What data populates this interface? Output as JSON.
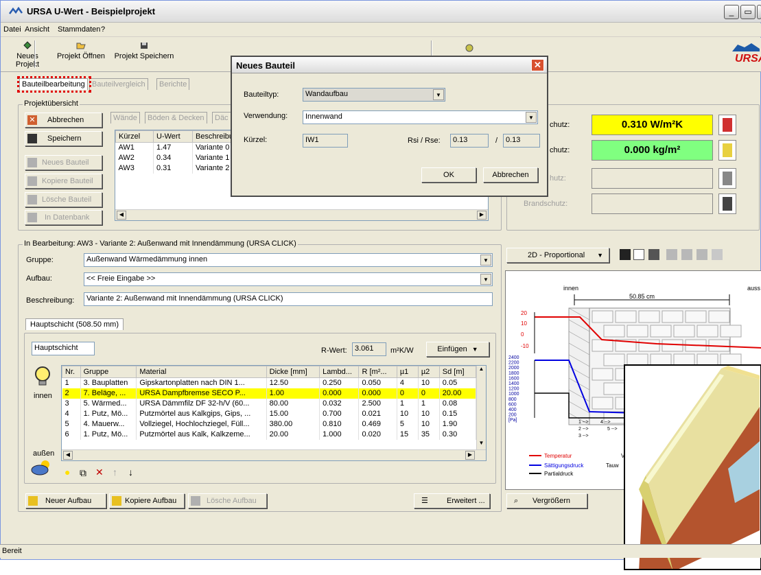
{
  "window": {
    "title": "URSA U-Wert - Beispielprojekt",
    "buttons": [
      "_",
      "▭",
      "✕"
    ]
  },
  "menu": [
    "Datei",
    "Ansicht",
    "Stammdaten",
    "?"
  ],
  "toolbar": {
    "items": [
      "Neues Projekt",
      "Projekt Öffnen",
      "Projekt Speichern"
    ],
    "brand": "URSA"
  },
  "main_tabs": [
    "Bauteilbearbeitung",
    "Bauteilvergleich",
    "Berichte"
  ],
  "project_overview": {
    "label": "Projektübersicht",
    "buttons": {
      "abbrechen": "Abbrechen",
      "speichern": "Speichern",
      "neues": "Neues Bauteil",
      "kopiere": "Kopiere Bauteil",
      "loesche": "Lösche Bauteil",
      "datenbank": "In Datenbank"
    },
    "category_tabs": [
      "Wände",
      "Böden & Decken",
      "Däc"
    ],
    "columns": [
      "Kürzel",
      "U-Wert",
      "Beschreibu"
    ],
    "rows": [
      [
        "AW1",
        "1.47",
        "Variante 0"
      ],
      [
        "AW2",
        "0.34",
        "Variante 1"
      ],
      [
        "AW3",
        "0.31",
        "Variante 2"
      ]
    ]
  },
  "results": {
    "rows": [
      {
        "label": "chutz:",
        "value": "0.310 W/m²K",
        "color": "#ffff00",
        "icon": "thermal-icon"
      },
      {
        "label": "chutz:",
        "value": "0.000 kg/m²",
        "color": "#80ff80",
        "icon": "moisture-icon"
      },
      {
        "label": "hutz:",
        "value": "",
        "color": "#ece9d8",
        "icon": "sound-icon"
      },
      {
        "label": "Brandschutz:",
        "value": "",
        "color": "#ece9d8",
        "icon": "fire-icon"
      }
    ]
  },
  "editing": {
    "title": "In Bearbeitung: AW3 - Variante 2: Außenwand mit Innendämmung (URSA CLICK)",
    "gruppe_label": "Gruppe:",
    "gruppe_value": "Außenwand Wärmedämmung innen",
    "aufbau_label": "Aufbau:",
    "aufbau_value": "<< Freie Eingabe >>",
    "beschreibung_label": "Beschreibung:",
    "beschreibung_value": "Variante 2: Außenwand mit Innendämmung (URSA CLICK)",
    "layer_tab": "Hauptschicht (508.50 mm)",
    "layer_name": "Hauptschicht",
    "r_wert_label": "R-Wert:",
    "r_wert_value": "3.061",
    "r_unit": "m²K/W",
    "einfuegen": "Einfügen",
    "innen": "innen",
    "aussen": "außen"
  },
  "layers": {
    "columns": [
      "Nr.",
      "Gruppe",
      "Material",
      "Dicke [mm]",
      "Lambd...",
      "R [m²...",
      "µ1",
      "µ2",
      "Sd [m]"
    ],
    "rows": [
      [
        "1",
        "3. Bauplatten",
        "Gipskartonplatten nach DIN 1...",
        "12.50",
        "0.250",
        "0.050",
        "4",
        "10",
        "0.05"
      ],
      [
        "2",
        "7. Beläge, ...",
        "URSA Dampfbremse SECO P...",
        "1.00",
        "0.000",
        "0.000",
        "0",
        "0",
        "20.00"
      ],
      [
        "3",
        "5. Wärmed...",
        "URSA Dämmfilz DF 32-h/V (60...",
        "80.00",
        "0.032",
        "2.500",
        "1",
        "1",
        "0.08"
      ],
      [
        "4",
        "1. Putz, Mö...",
        "Putzmörtel aus Kalkgips, Gips, ...",
        "15.00",
        "0.700",
        "0.021",
        "10",
        "10",
        "0.15"
      ],
      [
        "5",
        "4. Mauerw...",
        "Vollziegel, Hochlochziegel, Füll...",
        "380.00",
        "0.810",
        "0.469",
        "5",
        "10",
        "1.90"
      ],
      [
        "6",
        "1. Putz, Mö...",
        "Putzmörtel aus Kalk, Kalkzeme...",
        "20.00",
        "1.000",
        "0.020",
        "15",
        "35",
        "0.30"
      ]
    ],
    "selected_row": 1
  },
  "bottom_buttons": {
    "neuer": "Neuer Aufbau",
    "kopiere": "Kopiere Aufbau",
    "loesche": "Lösche Aufbau",
    "erweitert": "Erweitert ...",
    "vergroessern": "Vergrößern"
  },
  "view": {
    "mode": "2D - Proportional"
  },
  "chart": {
    "innen": "innen",
    "aussen": "auss",
    "width_label": "50.85 cm",
    "temp_ticks": [
      "20",
      "10",
      "0",
      "-10"
    ],
    "press_ticks": [
      "2400",
      "2200",
      "2000",
      "1800",
      "1600",
      "1400",
      "1200",
      "1000",
      "800",
      "600",
      "400",
      "200",
      "[Pa]"
    ],
    "markers": [
      "1 -->",
      "4 -->",
      "2 -->",
      "5 -->",
      "3 -->"
    ],
    "legend": [
      "Temperatur",
      "Sättigungsdruck",
      "Partialdruck"
    ],
    "extra_labels": [
      "V",
      "Tauw"
    ]
  },
  "dialog": {
    "title": "Neues Bauteil",
    "bauteiltyp_label": "Bauteiltyp:",
    "bauteiltyp_value": "Wandaufbau",
    "verwendung_label": "Verwendung:",
    "verwendung_value": "Innenwand",
    "kuerzel_label": "Kürzel:",
    "kuerzel_value": "IW1",
    "rsi_label": "Rsi / Rse:",
    "rsi_value": "0.13",
    "slash": "/",
    "rse_value": "0.13",
    "ok": "OK",
    "cancel": "Abbrechen"
  },
  "status": "Bereit"
}
